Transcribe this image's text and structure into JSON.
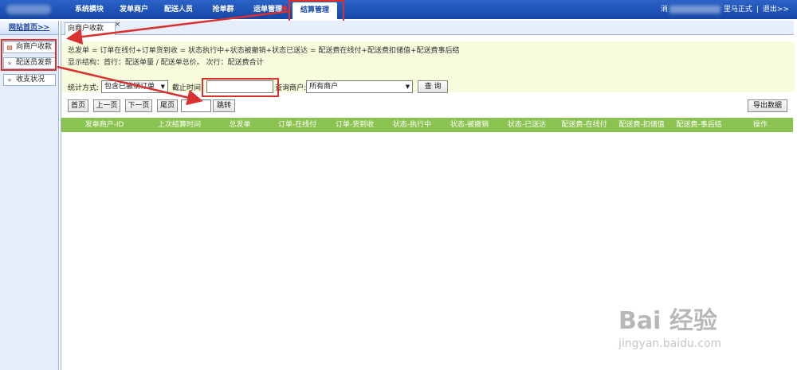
{
  "header": {
    "nav": [
      "系统模块",
      "发单商户",
      "配送人员",
      "抢单群",
      "运单管理",
      "结算管理"
    ],
    "active_index": 5,
    "user_prefix": "消",
    "user_suffix": "里马正式",
    "separator": "|",
    "logout": "退出>>"
  },
  "sidebar": {
    "home": "网站首页>>",
    "items": [
      {
        "label": "向商户收款",
        "icon": "document-icon"
      },
      {
        "label": "配送员发薪",
        "icon": "double-arrow-icon"
      },
      {
        "label": "收支状况",
        "icon": "double-arrow-icon"
      }
    ]
  },
  "tab": {
    "label": "向商户收款",
    "close": "×"
  },
  "notice": {
    "line1": "总发单 = 订单在线付+订单货到收 = 状态执行中+状态被撤销+状态已送达 = 配送费在线付+配送费扣储值+配送费事后结",
    "line2": "显示结构：首行：配送单量 / 配送单总价。 次行：配送费合计"
  },
  "filters": {
    "stat_label": "统计方式:",
    "stat_value": "包含已撤销订单",
    "time_label": "截止时间:",
    "time_value": "",
    "merchant_label": "查询商户:",
    "merchant_value": "所有商户",
    "query_button": "查 询"
  },
  "pager": {
    "first": "首页",
    "prev": "上一页",
    "next": "下一页",
    "last": "尾页",
    "page_value": "",
    "jump": "跳转",
    "export": "导出数据"
  },
  "table": {
    "columns": [
      "发单商户-ID",
      "上次结算时间",
      "总发单",
      "订单-在线付",
      "订单-货到收",
      "状态-执行中",
      "状态-被撤销",
      "状态-已送达",
      "配送费-在线付",
      "配送费-扣储值",
      "配送费-事后结",
      "操作"
    ]
  },
  "watermark": {
    "brand": "Bai 经验",
    "url": "jingyan.baidu.com"
  },
  "colors": {
    "topbar": "#1a4fb0",
    "table_header": "#8bc350",
    "notice_bg": "#f8fbdc",
    "annotation": "#d93030"
  }
}
